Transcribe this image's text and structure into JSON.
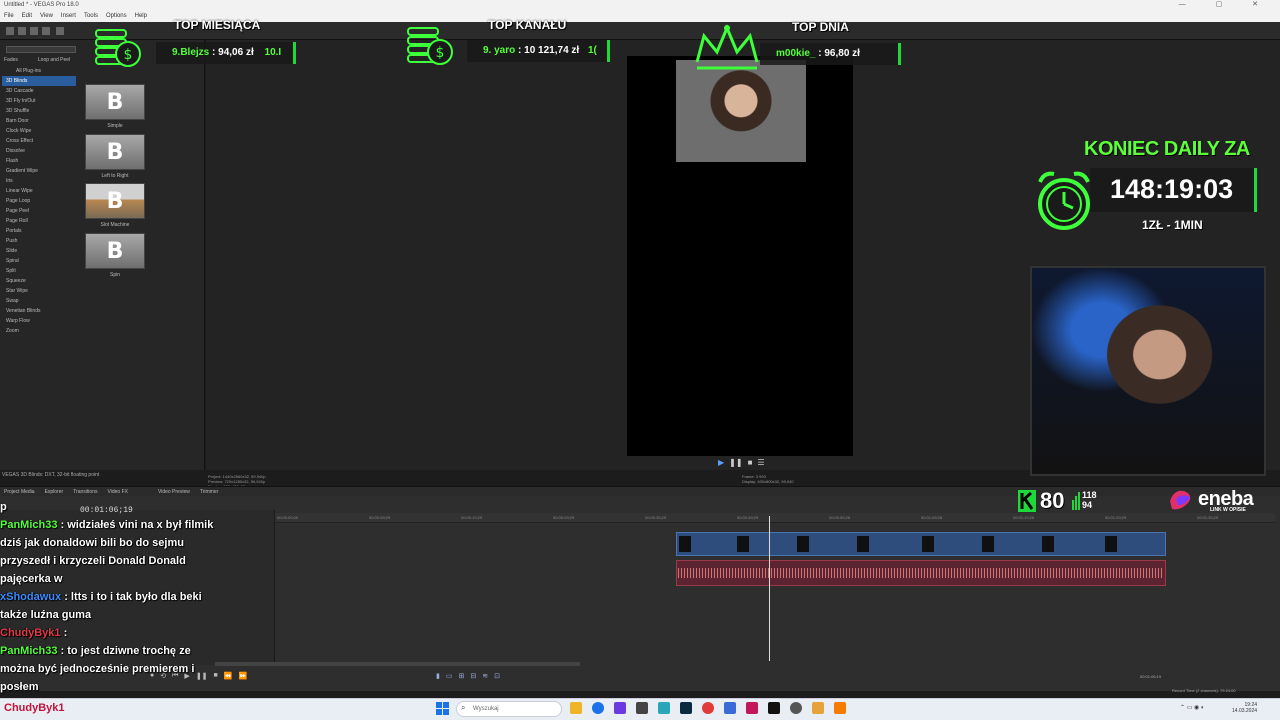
{
  "window": {
    "title": "Untitled * - VEGAS Pro 18.0",
    "controls": "— ▢ ✕"
  },
  "menu": [
    "File",
    "Edit",
    "View",
    "Insert",
    "Tools",
    "Options",
    "Help"
  ],
  "fx_panel": {
    "tabs": [
      "Fades",
      "Loop and Peel"
    ],
    "all_plugins": "All Plug-ins",
    "items": [
      "3D Blinds",
      "3D Cascade",
      "3D Fly In/Out",
      "3D Shuffle",
      "Barn Door",
      "Clock Wipe",
      "Cross Effect",
      "Dissolve",
      "Flash",
      "Gradient Wipe",
      "Iris",
      "Linear Wipe",
      "Page Loop",
      "Page Peel",
      "Page Roll",
      "Portals",
      "Push",
      "Slide",
      "Spiral",
      "Split",
      "Squeeze",
      "Star Wipe",
      "Swap",
      "Venetian Blinds",
      "Warp Flow",
      "Zoom"
    ],
    "thumbs": [
      {
        "glyph": "B",
        "label": "Simple"
      },
      {
        "glyph": "B",
        "label": "Left to Right"
      },
      {
        "glyph": "B",
        "label": "Slot Machine"
      },
      {
        "glyph": "B",
        "label": "Spin"
      }
    ],
    "status": "VEGAS 3D Blinds: DXT, 32-bit floating point"
  },
  "preview": {
    "info_lines": [
      "Project: 1440x2560x32, 59,940p",
      "Preview: 720x1280x32, 59,940p",
      "Display: 322x420x32"
    ],
    "info2_lines": [
      "Frame: 3 993",
      "Display: 400x800x32, 59,940"
    ]
  },
  "dock_tabs": [
    "Project Media",
    "Explorer",
    "Transitions",
    "Video FX",
    "Video Preview",
    "Trimmer"
  ],
  "timeline": {
    "timecode": "00:01:06;19",
    "ruler_ticks": [
      "00:00:00;00",
      "00:00:09;29",
      "00:00:19;29",
      "00:00:29;29",
      "00:00:39;29",
      "00:00:49;29",
      "00:00:59;28",
      "00:01:09;28",
      "00:01:19;28",
      "00:01:29;29",
      "00:01:39;29",
      "00:01:49;29"
    ],
    "status_time": "00:01:06;19",
    "record_time": "Record Time (2 channels): 79:24:00"
  },
  "overlay": {
    "top_month": {
      "title": "TOP MIESIĄCA",
      "name": "9.Blejzs",
      "amount": ": 94,06 zł",
      "next": "10.I"
    },
    "top_channel": {
      "title": "TOP KANAŁU",
      "name": "9. yaro",
      "amount": ": 10 121,74 zł",
      "next": "1("
    },
    "top_day": {
      "title": "TOP DNIA",
      "name": "m00kie_",
      "amount": ": 96,80 zł"
    },
    "timer": {
      "title": "KONIEC DAILY ZA",
      "value": "148:19:03",
      "rate": "1ZŁ - 1MIN"
    },
    "stats": {
      "k_value": "80",
      "viewers_top": "118",
      "viewers_bottom": "94"
    },
    "sponsor": {
      "name": "eneba",
      "sub": "LINK W OPISIE"
    }
  },
  "chat": [
    {
      "user": "",
      "text": "p",
      "color": "none"
    },
    {
      "user": "PanMich33",
      "text": ": widziałeś vini na x był filmik",
      "color": "green"
    },
    {
      "user": "",
      "text": "dziś jak donaldowi bili  bo do sejmu",
      "color": "none"
    },
    {
      "user": "",
      "text": "przyszedł  i krzyczeli Donald Donald",
      "color": "none"
    },
    {
      "user": "",
      "text": "pajęcerka w",
      "color": "none"
    },
    {
      "user": "xShodawux",
      "text": ": ltts i to i tak było dla beki",
      "color": "blue"
    },
    {
      "user": "",
      "text": "także luźna guma",
      "color": "none"
    },
    {
      "user": "ChudyByk1",
      "text": ":",
      "color": "red"
    },
    {
      "user": "PanMich33",
      "text": ": to jest dziwne trochę ze",
      "color": "green"
    },
    {
      "user": "",
      "text": "można być jednocześnie premierem i",
      "color": "none"
    },
    {
      "user": "",
      "text": "posłem",
      "color": "none"
    }
  ],
  "taskbar": {
    "user": "ChudyByk1",
    "search_placeholder": "Wyszukaj",
    "clock_time": "19:24",
    "clock_date": "14.03.2024"
  },
  "colors": {
    "accent_green": "#1fd83a",
    "chat_green": "#54ff3a",
    "vegas_blue": "#2a5d9e"
  }
}
